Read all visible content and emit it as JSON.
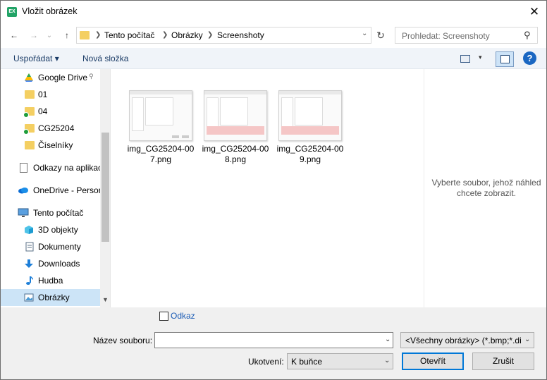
{
  "window": {
    "title": "Vložit obrázek",
    "app_icon_text": "EX",
    "close_glyph": "✕"
  },
  "nav": {
    "back_glyph": "←",
    "forward_glyph": "→",
    "history_glyph": "⌄",
    "up_glyph": "↑",
    "breadcrumbs": [
      "Tento počítač",
      "Obrázky",
      "Screenshoty"
    ],
    "refresh_glyph": "↻",
    "search_placeholder": "Prohledat: Screenshoty"
  },
  "toolbar": {
    "organize_label": "Uspořádat ▾",
    "new_folder_label": "Nová složka",
    "view_dd": "▾",
    "help_glyph": "?"
  },
  "sidebar": {
    "items": [
      {
        "label": "Google Drive",
        "icon": "google-drive-icon",
        "pin": "📌"
      },
      {
        "label": "01",
        "icon": "folder-icon"
      },
      {
        "label": "04",
        "icon": "folder-sync-icon"
      },
      {
        "label": "CG25204",
        "icon": "folder-sync-icon"
      },
      {
        "label": "Číselníky",
        "icon": "folder-icon"
      },
      {
        "label": "Odkazy na aplikac",
        "icon": "document-icon"
      },
      {
        "label": "OneDrive - Persor",
        "icon": "onedrive-icon"
      },
      {
        "label": "Tento počítač",
        "icon": "computer-icon"
      },
      {
        "label": "3D objekty",
        "icon": "3d-objects-icon"
      },
      {
        "label": "Dokumenty",
        "icon": "documents-icon"
      },
      {
        "label": "Downloads",
        "icon": "downloads-icon"
      },
      {
        "label": "Hudba",
        "icon": "music-icon"
      },
      {
        "label": "Obrázky",
        "icon": "pictures-icon",
        "selected": true
      }
    ]
  },
  "files": [
    {
      "name_line1": "img_CG25204-00",
      "name_line2": "7.png"
    },
    {
      "name_line1": "img_CG25204-00",
      "name_line2": "8.png"
    },
    {
      "name_line1": "img_CG25204-00",
      "name_line2": "9.png"
    }
  ],
  "preview": {
    "message": "Vyberte soubor, jehož náhled chcete zobrazit."
  },
  "footer": {
    "link_label": "Odkaz",
    "filename_label": "Název souboru:",
    "filename_value": "",
    "filter_value": "<Všechny obrázky> (*.bmp;*.dib;*.jpg)",
    "anchor_label": "Ukotvení:",
    "anchor_value": "K buňce",
    "open_label": "Otevřít",
    "cancel_label": "Zrušit"
  },
  "colors": {
    "accent": "#0078d7",
    "toolbar_bg": "#f0f4f9",
    "selected_bg": "#cce4f7",
    "link": "#1a5bb5"
  }
}
